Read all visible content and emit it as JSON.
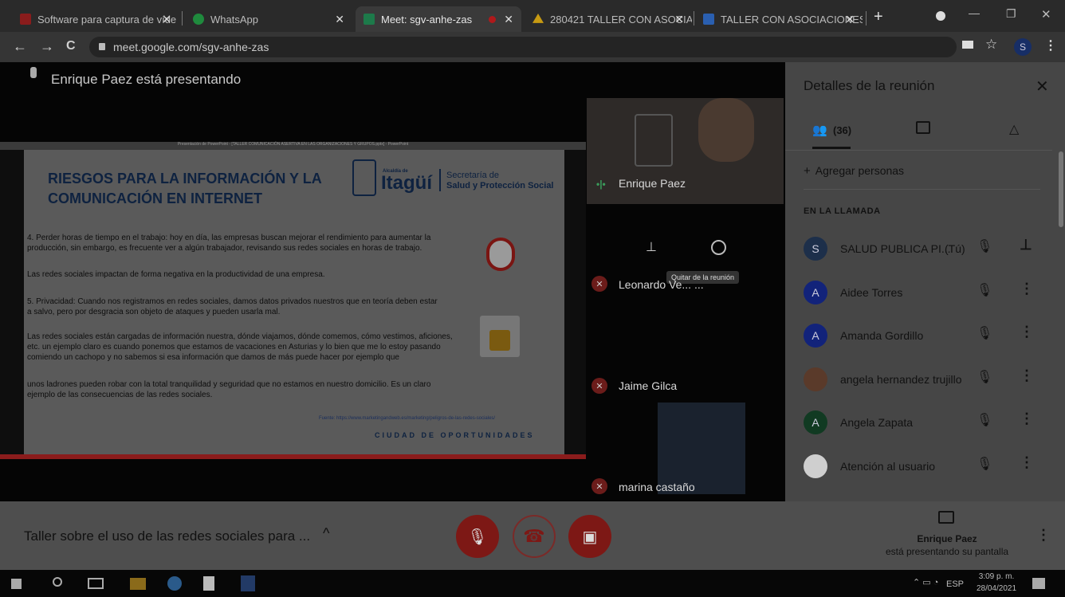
{
  "tabs": [
    {
      "label": "Software para captura de víde",
      "close": "✕",
      "favicon_color": "#8a1c1c"
    },
    {
      "label": "WhatsApp",
      "close": "✕",
      "favicon_color": "#1f8a3d"
    },
    {
      "label": "Meet: sgv-anhe-zas",
      "close": "✕",
      "favicon_color": "#1d7a4a"
    },
    {
      "label": "280421 TALLER CON ASOCIA",
      "close": "✕",
      "favicon_color": "#c79a12"
    },
    {
      "label": "TALLER CON ASOCIACIONES",
      "close": "✕",
      "favicon_color": "#2a5fb0"
    }
  ],
  "new_tab": "+",
  "window": {
    "minimize": "—",
    "restore": "❐",
    "close": "✕"
  },
  "nav": {
    "back": "←",
    "forward": "→",
    "reload": "C",
    "url": "meet.google.com/sgv-anhe-zas",
    "profile": "S"
  },
  "presenter_banner": "Enrique Paez está presentando",
  "slide": {
    "titlebar": "Presentación de PowerPoint - [TALLER COMUNICACIÓN ASERTIVA EN LAS ORGANIZACIONES Y GRUPOS.pptx] - PowerPoint",
    "title_line1": "RIESGOS PARA LA INFORMACIÓN Y LA",
    "title_line2": "COMUNICACIÓN EN INTERNET",
    "logo_small": "Alcaldía de",
    "logo_big": "Itagüí",
    "secretaria_1": "Secretaría de",
    "secretaria_2": "Salud y Protección Social",
    "p1": "4. Perder horas de tiempo en el trabajo: hoy en día, las empresas buscan mejorar el rendimiento para aumentar la producción, sin embargo, es frecuente ver a algún trabajador, revisando sus redes sociales en horas de trabajo.",
    "p1b": "Las redes sociales impactan de forma negativa en la productividad de una empresa.",
    "p2": "5. Privacidad: Cuando nos registramos en redes sociales, damos datos privados nuestros que en teoría deben estar a salvo, pero por desgracia son objeto de ataques y pueden usarla mal.",
    "p3": "Las redes sociales están cargadas de información nuestra, dónde viajamos, dónde comemos, cómo vestimos, aficiones, etc. un ejemplo claro es cuando ponemos que estamos de vacaciones en Asturias y lo bien que me lo estoy pasando comiendo un cachopo y no sabemos si esa información que damos de más puede hacer por ejemplo que",
    "p4": "unos ladrones pueden robar con la total tranquilidad y seguridad que no estamos en nuestro domicilio. Es un claro ejemplo de las consecuencias de las redes sociales.",
    "source": "Fuente: https://www.marketingandweb.es/marketing/peligros-de-las-redes-sociales/",
    "footer": "CIUDAD DE OPORTUNIDADES"
  },
  "tiles": [
    {
      "name": "Enrique Paez"
    },
    {
      "name": "Leonardo Ve... ..."
    },
    {
      "name": "Jaime Gilca"
    },
    {
      "name": "marina castaño"
    }
  ],
  "tile_tooltip": "Quitar de la reunión",
  "sidebar": {
    "title": "Detalles de la reunión",
    "close": "✕",
    "people_count": "(36)",
    "add_people": "Agregar personas",
    "section": "EN LA LLAMADA",
    "participants": [
      {
        "initial": "S",
        "name": "SALUD PUBLICA PI...",
        "suffix": "(Tú)",
        "color": "#1d2f4a"
      },
      {
        "initial": "A",
        "name": "Aidee Torres",
        "suffix": "",
        "color": "#12237a"
      },
      {
        "initial": "A",
        "name": "Amanda Gordillo",
        "suffix": "",
        "color": "#12237a"
      },
      {
        "initial": "",
        "name": "angela hernandez trujillo",
        "suffix": "",
        "color": "#5a3a2a"
      },
      {
        "initial": "A",
        "name": "Angela Zapata",
        "suffix": "",
        "color": "#113a22"
      },
      {
        "initial": "",
        "name": "Atención al usuario",
        "suffix": "",
        "color": "#cfcfcf"
      }
    ]
  },
  "bottom": {
    "meeting_title": "Taller sobre el uso de las redes sociales para ...",
    "presenter_name": "Enrique Paez",
    "presenter_status": "está presentando su pantalla"
  },
  "taskbar": {
    "lang": "ESP",
    "time": "3:09 p. m.",
    "date": "28/04/2021"
  }
}
